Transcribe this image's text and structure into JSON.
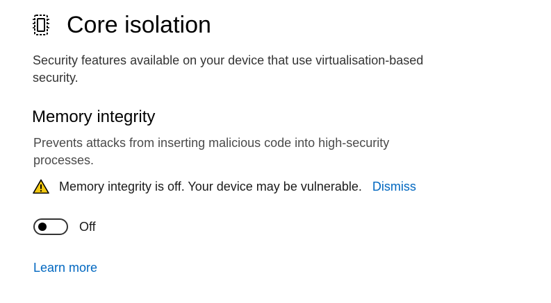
{
  "header": {
    "title": "Core isolation",
    "icon": "core-isolation-chip-icon"
  },
  "description": "Security features available on your device that use virtualisation-based security.",
  "memory_integrity": {
    "title": "Memory integrity",
    "description": "Prevents attacks from inserting malicious code into high-security processes.",
    "warning": {
      "icon": "warning-triangle-icon",
      "text": "Memory integrity is off. Your device may be vulnerable.",
      "dismiss_label": "Dismiss"
    },
    "toggle": {
      "state": "off",
      "label": "Off"
    }
  },
  "learn_more_label": "Learn more",
  "colors": {
    "link": "#0067c0",
    "warning_fill": "#f2c811",
    "text": "#000000"
  }
}
